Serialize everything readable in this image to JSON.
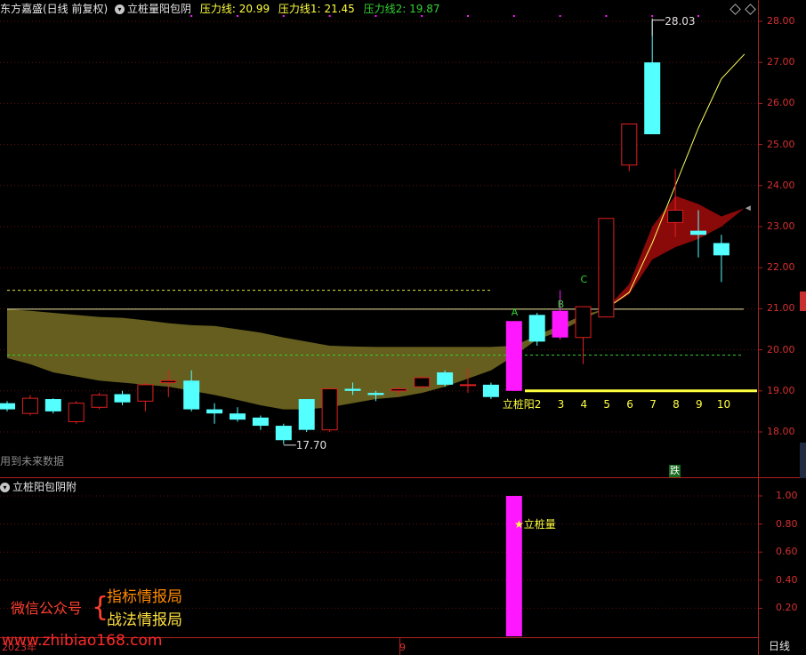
{
  "header": {
    "stock_title": "东方嘉盛(日线 前复权)",
    "indicator_name": "立桩量阳包阴",
    "pressure_main_label": "压力线:",
    "pressure_main_value": "20.99",
    "pressure_1_label": "压力线1:",
    "pressure_1_value": "21.45",
    "pressure_2_label": "压力线2:",
    "pressure_2_value": "19.87"
  },
  "main_chart": {
    "y_ticks": [
      "28.00",
      "27.00",
      "26.00",
      "25.00",
      "24.00",
      "23.00",
      "22.00",
      "21.00",
      "20.00",
      "19.00",
      "18.00"
    ],
    "high_marker": "28.03",
    "low_marker": "17.70",
    "future_data_note": "用到未来数据",
    "point_labels": [
      "A",
      "B",
      "C"
    ],
    "count_labels": [
      "立桩阳",
      "2",
      "3",
      "4",
      "5",
      "6",
      "7",
      "8",
      "9",
      "10"
    ],
    "drop_badge": "跌"
  },
  "sub_chart": {
    "indicator_name": "立桩阳包阴附",
    "y_ticks": [
      "1.00",
      "0.80",
      "0.60",
      "0.40",
      "0.20"
    ],
    "signal_label": "立桩量"
  },
  "watermark": {
    "wechat_label": "微信公众号",
    "line1": "指标情报局",
    "line2": "战法情报局",
    "site": "www.zhibiao168.com"
  },
  "footer": {
    "year_label": "2023年",
    "month_label": "9",
    "period_label": "日线"
  },
  "colors": {
    "up": "#e02020",
    "down": "#54ffff",
    "magenta": "#ff18ff",
    "band": "#6b6320",
    "cloud": "#8a0a0a",
    "yellow": "#ffff40",
    "green": "#32d232"
  },
  "chart_data": {
    "type": "candlestick",
    "ylim": [
      17.1,
      28.2
    ],
    "candles": [
      {
        "o": 18.7,
        "c": 18.55,
        "h": 18.75,
        "l": 18.5
      },
      {
        "o": 18.45,
        "c": 18.82,
        "h": 18.9,
        "l": 18.4
      },
      {
        "o": 18.8,
        "c": 18.5,
        "h": 18.82,
        "l": 18.45
      },
      {
        "o": 18.25,
        "c": 18.7,
        "h": 18.75,
        "l": 18.2
      },
      {
        "o": 18.6,
        "c": 18.9,
        "h": 18.95,
        "l": 18.55
      },
      {
        "o": 18.92,
        "c": 18.72,
        "h": 19.0,
        "l": 18.65
      },
      {
        "o": 18.75,
        "c": 19.15,
        "h": 19.2,
        "l": 18.5
      },
      {
        "o": 19.2,
        "c": 19.25,
        "h": 19.5,
        "l": 18.85
      },
      {
        "o": 19.25,
        "c": 18.55,
        "h": 19.5,
        "l": 18.5
      },
      {
        "o": 18.55,
        "c": 18.45,
        "h": 18.7,
        "l": 18.2
      },
      {
        "o": 18.45,
        "c": 18.3,
        "h": 18.6,
        "l": 18.25
      },
      {
        "o": 18.35,
        "c": 18.15,
        "h": 18.4,
        "l": 18.05
      },
      {
        "o": 18.15,
        "c": 17.8,
        "h": 18.2,
        "l": 17.7
      },
      {
        "o": 18.8,
        "c": 18.05,
        "h": 18.8,
        "l": 18.0
      },
      {
        "o": 18.05,
        "c": 19.05,
        "h": 19.05,
        "l": 18.0
      },
      {
        "o": 19.05,
        "c": 19.0,
        "h": 19.2,
        "l": 18.9
      },
      {
        "o": 18.95,
        "c": 18.9,
        "h": 19.0,
        "l": 18.75
      },
      {
        "o": 19.0,
        "c": 19.05,
        "h": 19.1,
        "l": 18.9
      },
      {
        "o": 19.1,
        "c": 19.32,
        "h": 19.35,
        "l": 19.05
      },
      {
        "o": 19.45,
        "c": 19.15,
        "h": 19.5,
        "l": 19.1
      },
      {
        "o": 19.15,
        "c": 19.15,
        "h": 19.55,
        "l": 18.95
      },
      {
        "o": 19.15,
        "c": 18.85,
        "h": 19.2,
        "l": 18.8
      },
      {
        "o": 19.0,
        "c": 20.7,
        "h": 20.7,
        "l": 19.0,
        "magenta": true
      },
      {
        "o": 20.85,
        "c": 20.2,
        "h": 20.9,
        "l": 20.1
      },
      {
        "o": 20.3,
        "c": 20.95,
        "h": 21.45,
        "l": 20.25,
        "magenta": true
      },
      {
        "o": 20.3,
        "c": 21.05,
        "h": 21.05,
        "l": 19.65
      },
      {
        "o": 20.8,
        "c": 23.2,
        "h": 23.2,
        "l": 20.8
      },
      {
        "o": 24.5,
        "c": 25.5,
        "h": 25.5,
        "l": 24.35
      },
      {
        "o": 27.0,
        "c": 25.25,
        "h": 28.03,
        "l": 25.25
      },
      {
        "o": 23.1,
        "c": 23.4,
        "h": 24.4,
        "l": 22.75
      },
      {
        "o": 22.9,
        "c": 22.8,
        "h": 23.4,
        "l": 22.25
      },
      {
        "o": 22.6,
        "c": 22.3,
        "h": 22.8,
        "l": 21.65
      }
    ],
    "sub_values": [
      0,
      0,
      0,
      0,
      0,
      0,
      0,
      0,
      0,
      0,
      0,
      0,
      0,
      0,
      0,
      0,
      0,
      0,
      0,
      0,
      0,
      0,
      1,
      0,
      0,
      0,
      0,
      0,
      0,
      0,
      0,
      0
    ]
  }
}
